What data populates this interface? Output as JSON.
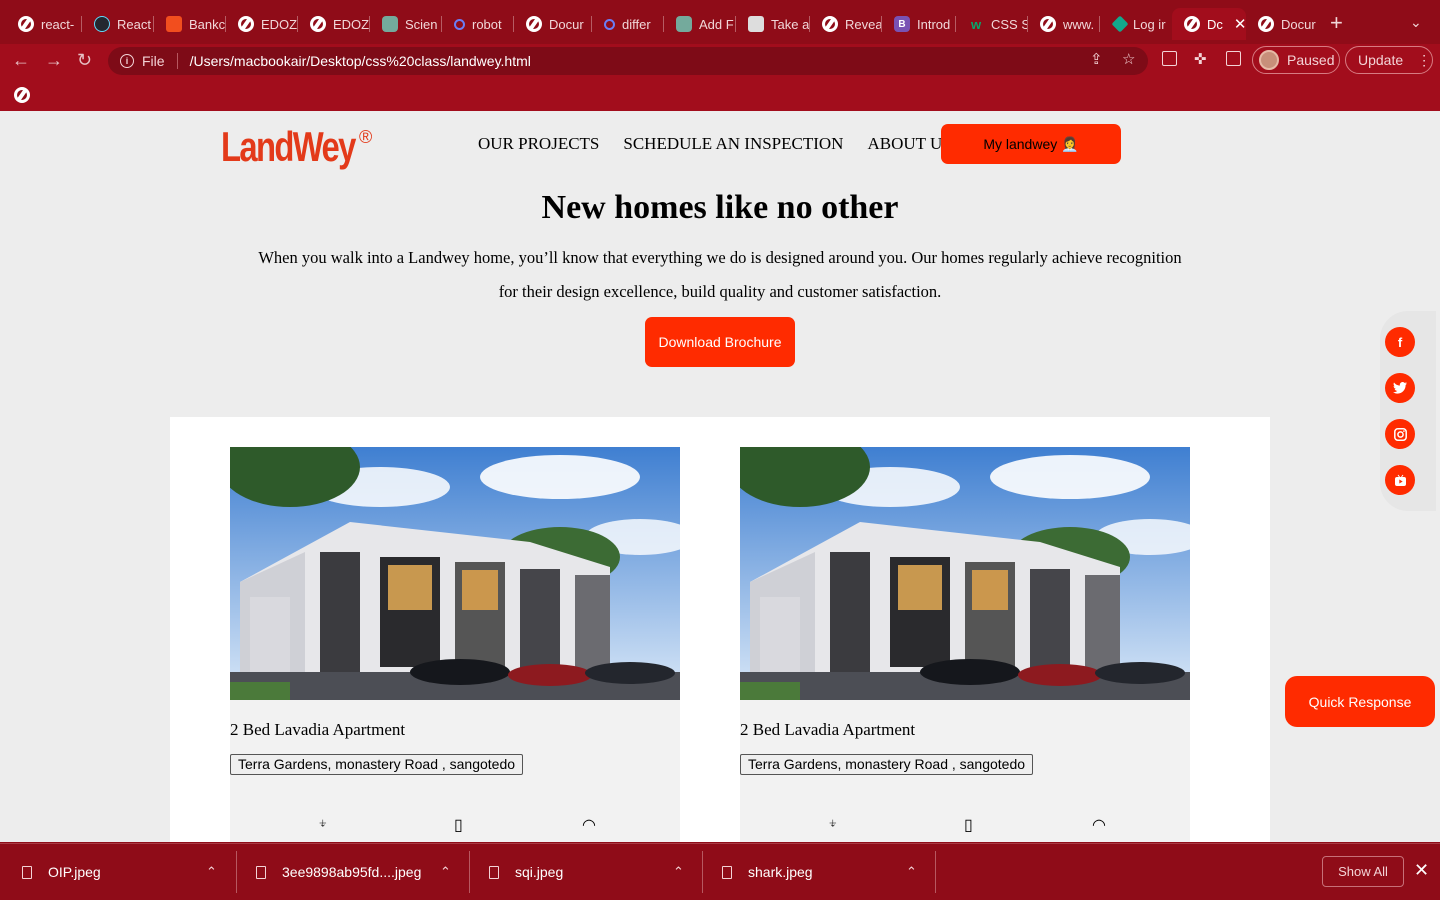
{
  "browser": {
    "tabs": [
      {
        "label": "react-",
        "icon": "globe-icon"
      },
      {
        "label": "React",
        "icon": "react-icon"
      },
      {
        "label": "Bankc",
        "icon": "figma-icon"
      },
      {
        "label": "EDOZ",
        "icon": "globe-icon"
      },
      {
        "label": "EDOZ",
        "icon": "globe-icon"
      },
      {
        "label": "Scien",
        "icon": "chatgpt-icon"
      },
      {
        "label": "robot",
        "icon": "search-icon"
      },
      {
        "label": "Docur",
        "icon": "globe-icon"
      },
      {
        "label": "differ",
        "icon": "search-icon"
      },
      {
        "label": "Add F",
        "icon": "chatgpt-icon"
      },
      {
        "label": "Take a",
        "icon": "apple-icon"
      },
      {
        "label": "Revea",
        "icon": "globe-icon"
      },
      {
        "label": "Introd",
        "icon": "bootstrap-icon"
      },
      {
        "label": "CSS S",
        "icon": "w3schools-icon"
      },
      {
        "label": "www.",
        "icon": "globe-icon"
      },
      {
        "label": "Log ir",
        "icon": "diamond-icon"
      },
      {
        "label": "Dc",
        "icon": "globe-icon",
        "active": true
      },
      {
        "label": "Docur",
        "icon": "globe-icon"
      }
    ],
    "new_tab": "+",
    "tab_search": "⌄",
    "scheme": "File",
    "url": "/Users/macbookair/Desktop/css%20class/landwey.html",
    "profile_status": "Paused",
    "update_label": "Update"
  },
  "page": {
    "logo_text": "LandWey",
    "nav": [
      "OUR PROJECTS",
      "SCHEDULE AN INSPECTION",
      "ABOUT US"
    ],
    "my_landwey_label": "My landwey",
    "hero": {
      "title": "New homes like no other",
      "text": "When you walk into a Landwey home, you’ll know that everything we do is designed around you. Our homes regularly achieve recognition for their design excellence, build quality and customer satisfaction.",
      "brochure_label": "Download Brochure"
    },
    "social": [
      {
        "name": "facebook",
        "glyph": "f"
      },
      {
        "name": "twitter",
        "glyph": "t"
      },
      {
        "name": "instagram",
        "glyph": "◎"
      },
      {
        "name": "youtube",
        "glyph": "▶"
      }
    ],
    "quick_response_label": "Quick Response",
    "projects": [
      {
        "title": "2 Bed Lavadia Apartment",
        "location": "Terra Gardens, monastery Road , sangotedo"
      },
      {
        "title": "2 Bed Lavadia Apartment",
        "location": "Terra Gardens, monastery Road , sangotedo"
      }
    ],
    "accent_color": "#ff2b00"
  },
  "downloads": {
    "items": [
      "OIP.jpeg",
      "3ee9898ab95fd....jpeg",
      "sqi.jpeg",
      "shark.jpeg"
    ],
    "show_all_label": "Show All"
  }
}
